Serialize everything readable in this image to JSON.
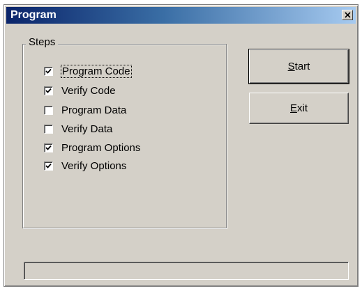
{
  "window": {
    "title": "Program",
    "close_icon": "close-icon"
  },
  "steps_group": {
    "label": "Steps",
    "items": [
      {
        "label": "Program Code",
        "checked": true
      },
      {
        "label": "Verify Code",
        "checked": true
      },
      {
        "label": "Program Data",
        "checked": false
      },
      {
        "label": "Verify Data",
        "checked": false
      },
      {
        "label": "Program Options",
        "checked": true
      },
      {
        "label": "Verify Options",
        "checked": true
      }
    ]
  },
  "buttons": {
    "start": {
      "first": "S",
      "rest": "tart"
    },
    "exit": {
      "first": "E",
      "rest": "xit"
    }
  },
  "progress": {
    "value": 0
  }
}
